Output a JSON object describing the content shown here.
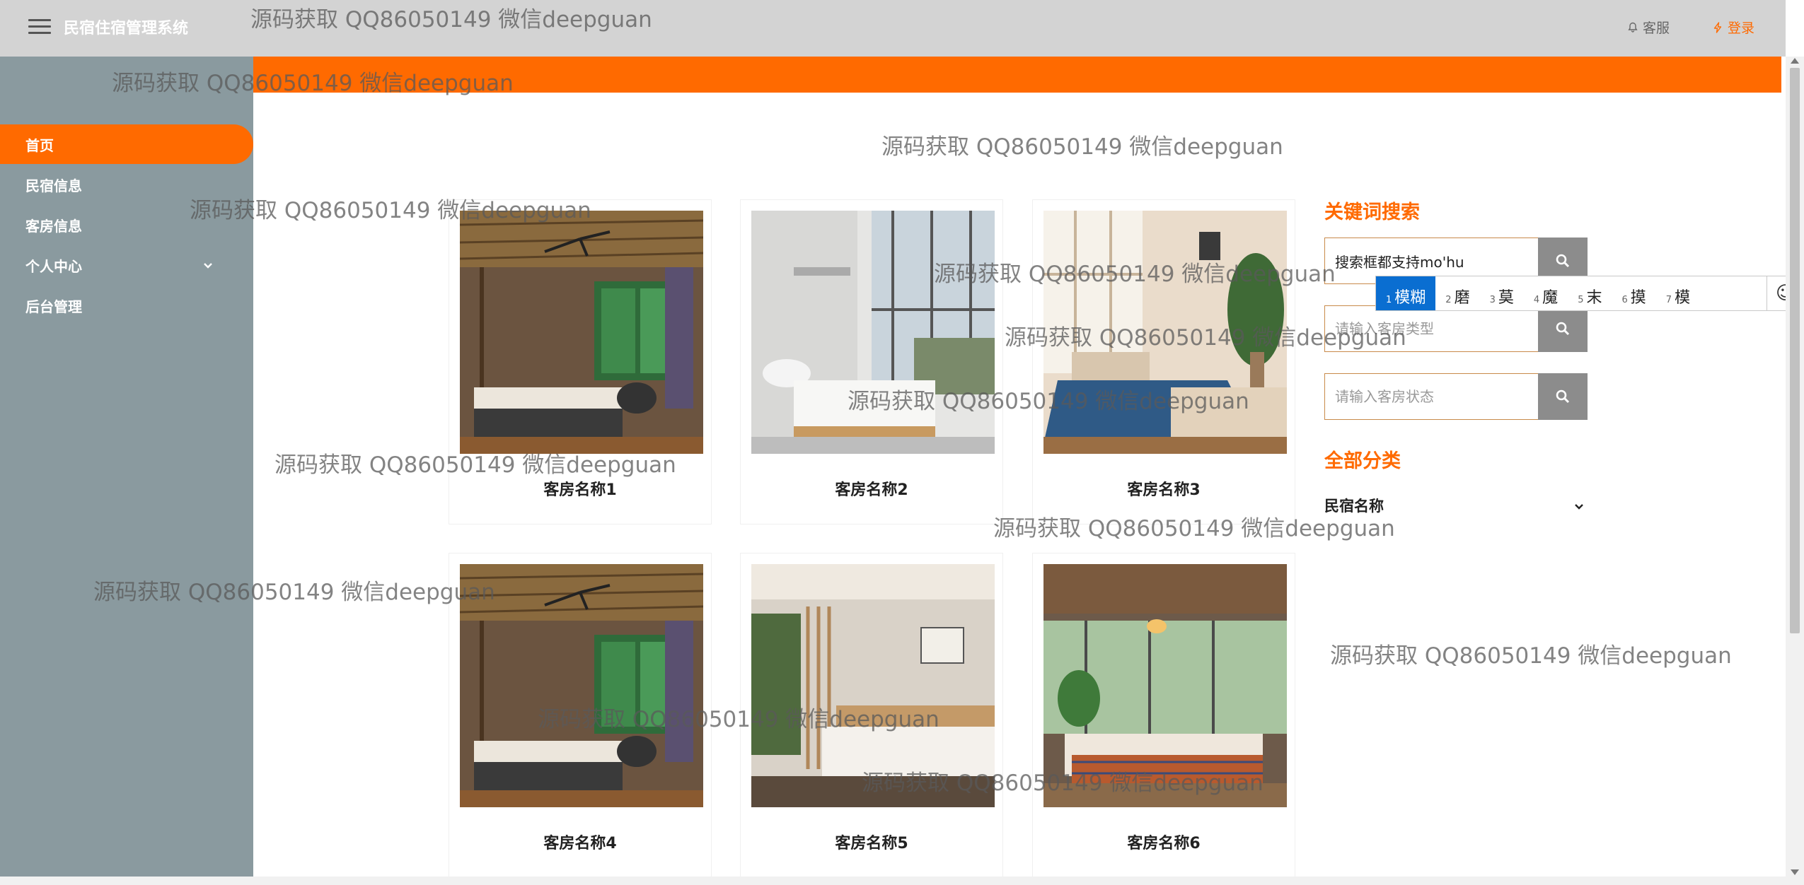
{
  "header": {
    "app_title": "民宿住宿管理系统",
    "service_label": "客服",
    "login_label": "登录"
  },
  "sidebar": {
    "items": [
      {
        "label": "首页"
      },
      {
        "label": "民宿信息"
      },
      {
        "label": "客房信息"
      },
      {
        "label": "个人中心"
      },
      {
        "label": "后台管理"
      }
    ]
  },
  "rooms": [
    {
      "name": "客房名称1"
    },
    {
      "name": "客房名称2"
    },
    {
      "name": "客房名称3"
    },
    {
      "name": "客房名称4"
    },
    {
      "name": "客房名称5"
    },
    {
      "name": "客房名称6"
    }
  ],
  "search": {
    "title": "关键词搜索",
    "keyword_value": "搜索框都支持mo'hu",
    "type_placeholder": "请输入客房类型",
    "status_placeholder": "请输入客房状态"
  },
  "categories": {
    "title": "全部分类",
    "item_label": "民宿名称"
  },
  "ime": {
    "candidates": [
      {
        "num": "1",
        "text": "模糊"
      },
      {
        "num": "2",
        "text": "磨"
      },
      {
        "num": "3",
        "text": "莫"
      },
      {
        "num": "4",
        "text": "魔"
      },
      {
        "num": "5",
        "text": "末"
      },
      {
        "num": "6",
        "text": "摸"
      },
      {
        "num": "7",
        "text": "模"
      }
    ],
    "emoji": "☺"
  },
  "watermark": "源码获取 QQ86050149 微信deepguan",
  "colors": {
    "accent": "#ff6a00",
    "sidebar": "#8a9a9f",
    "header": "#d3d3d3",
    "ime_selected": "#0a6ed1"
  }
}
